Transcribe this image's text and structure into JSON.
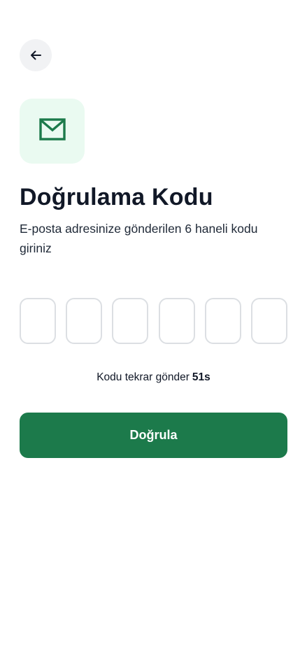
{
  "header": {
    "back_icon": "arrow-left-icon"
  },
  "hero": {
    "icon": "mail-icon",
    "accent_color": "#1c7a4b",
    "tile_color": "#eafaf1"
  },
  "title": "Doğrulama Kodu",
  "subtitle": "E-posta adresinize gönderilen 6 haneli kodu giriniz",
  "otp": {
    "length": 6,
    "digits": [
      "",
      "",
      "",
      "",
      "",
      ""
    ]
  },
  "resend": {
    "label": "Kodu tekrar gönder",
    "timer": "51s"
  },
  "verify_button": {
    "label": "Doğrula",
    "color": "#1c7a4b"
  }
}
